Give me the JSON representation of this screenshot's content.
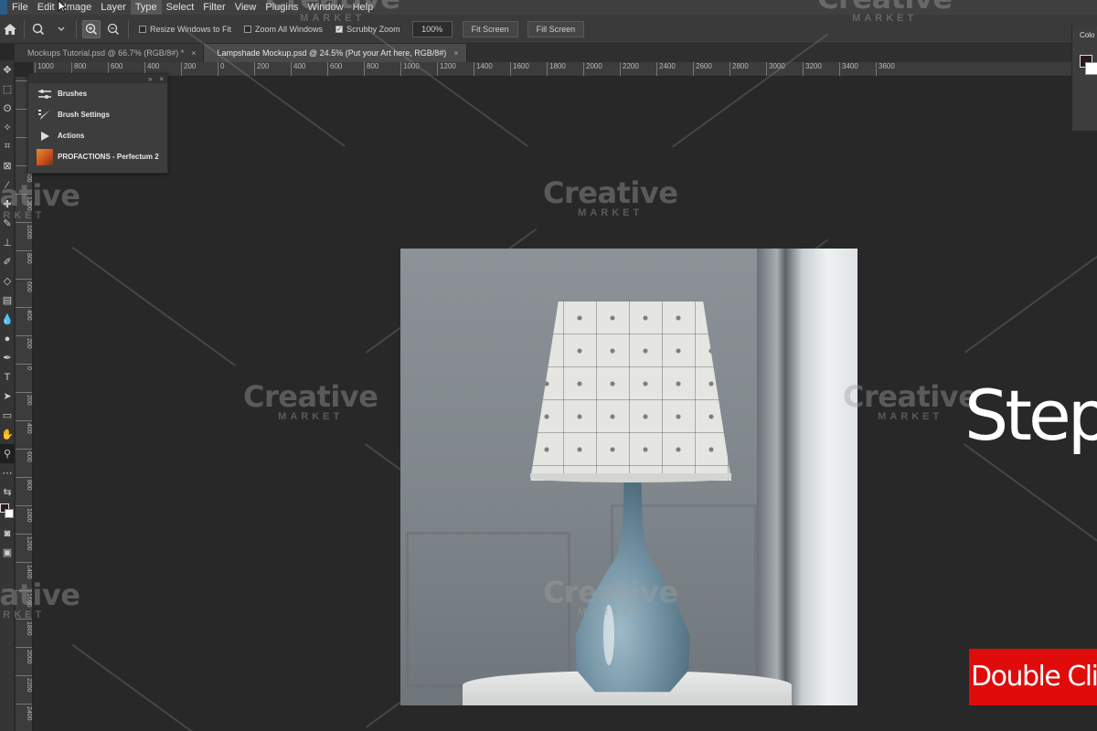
{
  "menu": {
    "items": [
      "File",
      "Edit",
      "Image",
      "Layer",
      "Type",
      "Select",
      "Filter",
      "View",
      "Plugins",
      "Window",
      "Help"
    ],
    "active_index": 4
  },
  "options_bar": {
    "resize_windows_label": "Resize Windows to Fit",
    "resize_windows_checked": false,
    "zoom_all_windows_label": "Zoom All Windows",
    "zoom_all_windows_checked": false,
    "scrubby_zoom_label": "Scrubby Zoom",
    "scrubby_zoom_checked": true,
    "zoom_value": "100%",
    "fit_screen_label": "Fit Screen",
    "fill_screen_label": "Fill Screen"
  },
  "tabs": [
    {
      "label": "Mockups Tutorial.psd @ 66.7% (RGB/8#) *",
      "active": false
    },
    {
      "label": "Lampshade Mockup.psd @ 24.5% (Put your Art here, RGB/8#)",
      "active": true
    }
  ],
  "ruler_top": [
    "1000",
    "800",
    "600",
    "400",
    "200",
    "0",
    "200",
    "400",
    "600",
    "800",
    "1000",
    "1200",
    "1400",
    "1600",
    "1800",
    "2000",
    "2200",
    "2400",
    "2600",
    "2800",
    "3000",
    "3200",
    "3400",
    "3600"
  ],
  "ruler_left": [
    "2000",
    "1800",
    "1600",
    "1400",
    "1200",
    "1000",
    "800",
    "600",
    "400",
    "200",
    "0",
    "200",
    "400",
    "600",
    "800",
    "1000",
    "1200",
    "1400",
    "1600",
    "1800",
    "2000",
    "2200",
    "2400"
  ],
  "panels": {
    "items": [
      {
        "label": "Brushes",
        "icon": "brushes-icon"
      },
      {
        "label": "Brush Settings",
        "icon": "brush-settings-icon"
      },
      {
        "label": "Actions",
        "icon": "actions-play-icon"
      },
      {
        "label": "PROFACTIONS - Perfectum 2",
        "icon": "profactions-thumbnail"
      }
    ]
  },
  "color_panel": {
    "label": "Colo",
    "foreground": "#2a1a1e",
    "background": "#ffffff"
  },
  "watermark": {
    "brand": "Creative",
    "sub": "MARKET"
  },
  "overlay": {
    "step_text": "Step",
    "double_click_text": "Double Clic"
  },
  "colors": {
    "canvas_bg": "#282828",
    "accent_red": "#e00b0b",
    "panel_bg": "#3d3d3d"
  }
}
